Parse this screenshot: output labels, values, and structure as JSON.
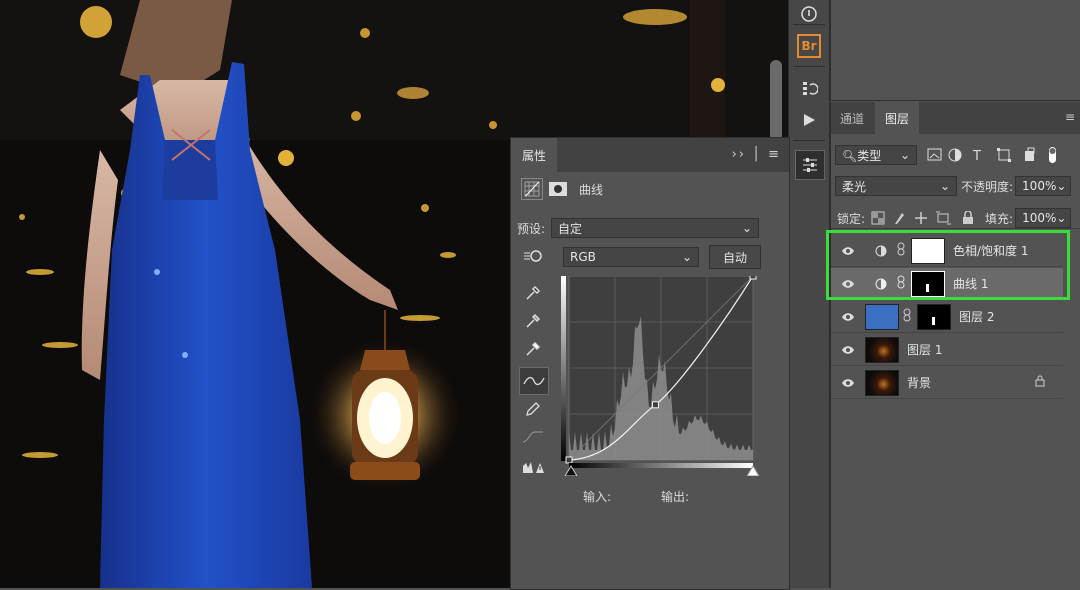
{
  "toolbar": {
    "bridge_label": "Br"
  },
  "properties": {
    "tab_label": "属性",
    "adjustment_name": "曲线",
    "preset_label": "预设:",
    "preset_value": "自定",
    "channel_value": "RGB",
    "auto_button": "自动",
    "input_label": "输入:",
    "output_label": "输出:",
    "curve_points": [
      [
        0,
        0
      ],
      [
        0.47,
        0.3
      ],
      [
        1,
        1
      ]
    ]
  },
  "layers": {
    "tabs": [
      "通道",
      "图层"
    ],
    "filter_label": "类型",
    "blend_mode": "柔光",
    "opacity_label": "不透明度:",
    "opacity_value": "100%",
    "lock_label": "锁定:",
    "fill_label": "填充:",
    "fill_value": "100%",
    "items": [
      {
        "name": "色相/饱和度 1",
        "type": "adjustment",
        "visible": true,
        "selected": false
      },
      {
        "name": "曲线 1",
        "type": "adjustment",
        "visible": true,
        "selected": true
      },
      {
        "name": "图层 2",
        "type": "color",
        "color": "#3a6fc2",
        "visible": true,
        "selected": false
      },
      {
        "name": "图层 1",
        "type": "photo",
        "visible": true,
        "selected": false
      },
      {
        "name": "背景",
        "type": "photo",
        "visible": true,
        "selected": false,
        "locked": true
      }
    ]
  },
  "colors": {
    "highlight": "#3ddc3d",
    "dress_blue": "#1f46b8"
  }
}
